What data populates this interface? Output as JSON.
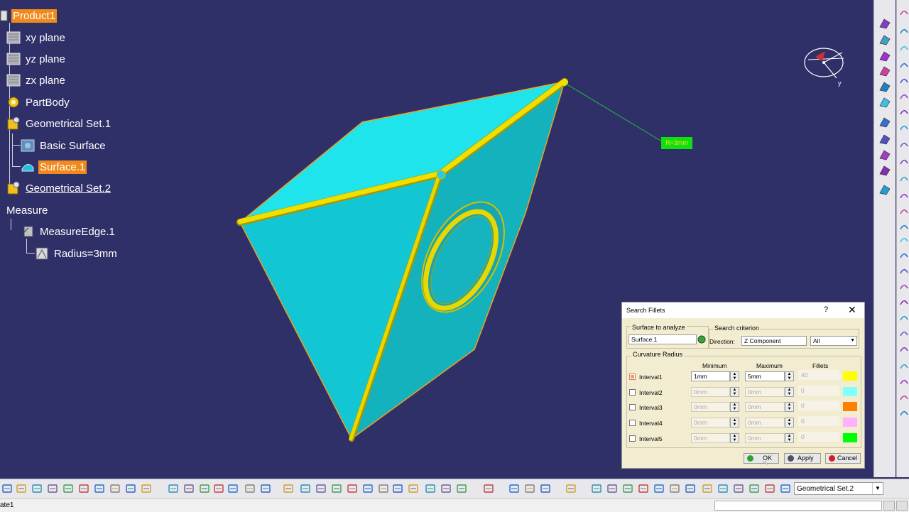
{
  "tree": {
    "root": "Product1",
    "xy": "xy plane",
    "yz": "yz plane",
    "zx": "zx plane",
    "partbody": "PartBody",
    "geoset1": "Geometrical Set.1",
    "basic_surface": "Basic Surface",
    "surface1": "Surface.1",
    "geoset2": "Geometrical Set.2",
    "measure": "Measure",
    "measure_edge": "MeasureEdge.1",
    "radius": "Radius=3mm"
  },
  "viewport": {
    "radius_label": "R=3mm",
    "compass_axis": "y"
  },
  "dialog": {
    "title": "Search Fillets",
    "help": "?",
    "close": "✕",
    "surface_group": "Surface to analyze",
    "surface_value": "Surface.1",
    "criterion_group": "Search criterion",
    "direction_label": "Direction:",
    "direction_value": "Z Component",
    "filter_value": "All",
    "curvature_group": "Curvature Radius",
    "col_min": "Minimum",
    "col_max": "Maximum",
    "col_fillets": "Fillets",
    "intervals": [
      {
        "label": "Interval1",
        "min": "1mm",
        "max": "5mm",
        "fillets": "40",
        "color": "#ffff00",
        "checked": true
      },
      {
        "label": "Interval2",
        "min": "0mm",
        "max": "0mm",
        "fillets": "0",
        "color": "#80ffff",
        "checked": false
      },
      {
        "label": "Interval3",
        "min": "0mm",
        "max": "0mm",
        "fillets": "0",
        "color": "#ff8000",
        "checked": false
      },
      {
        "label": "Interval4",
        "min": "0mm",
        "max": "0mm",
        "fillets": "0",
        "color": "#ffb0ff",
        "checked": false
      },
      {
        "label": "Interval5",
        "min": "0mm",
        "max": "0mm",
        "fillets": "0",
        "color": "#00ff00",
        "checked": false
      }
    ],
    "ok": "OK",
    "apply": "Apply",
    "cancel": "Cancel"
  },
  "bottom_toolbar": {
    "combo_value": "Geometrical Set.2"
  },
  "status": {
    "text": "ate1"
  },
  "colors": {
    "background": "#303068",
    "selection": "#f08a1c",
    "surface": "#1ed8e8",
    "fillet": "#f0e000"
  }
}
